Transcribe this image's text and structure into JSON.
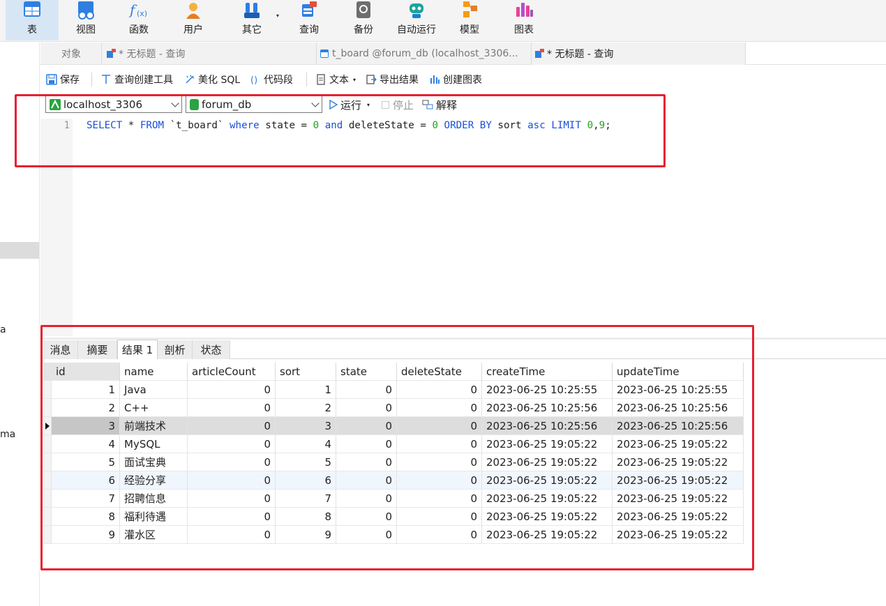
{
  "ribbon": {
    "items": [
      {
        "label": "表",
        "icon": "table-icon"
      },
      {
        "label": "视图",
        "icon": "view-icon"
      },
      {
        "label": "函数",
        "icon": "function-icon"
      },
      {
        "label": "用户",
        "icon": "user-icon"
      },
      {
        "label": "其它",
        "icon": "other-icon"
      },
      {
        "label": "查询",
        "icon": "query-icon"
      },
      {
        "label": "备份",
        "icon": "backup-icon"
      },
      {
        "label": "自动运行",
        "icon": "automation-icon"
      },
      {
        "label": "模型",
        "icon": "model-icon"
      },
      {
        "label": "图表",
        "icon": "chart-icon"
      }
    ],
    "dropdown_glyph": "▾"
  },
  "sidebar": {
    "fragment_1": "a",
    "fragment_2": "ma"
  },
  "tabs": [
    {
      "label": "对象"
    },
    {
      "label": "* 无标题 - 查询"
    },
    {
      "label": "t_board @forum_db (localhost_3306..."
    },
    {
      "label": "* 无标题 - 查询"
    }
  ],
  "editor_toolbar": {
    "save": "保存",
    "query_builder": "查询创建工具",
    "beautify": "美化 SQL",
    "snippet": "代码段",
    "text": "文本",
    "export": "导出结果",
    "create_chart": "创建图表"
  },
  "connection": {
    "server": "localhost_3306",
    "database": "forum_db",
    "run": "运行",
    "stop": "停止",
    "explain": "解释"
  },
  "editor": {
    "line_number": "1",
    "sql": {
      "t1": "SELECT",
      "t2": " * ",
      "t3": "FROM",
      "t4": " `t_board` ",
      "t5": "where",
      "t6": " state = ",
      "t7": "0",
      "t8": " ",
      "t9": "and",
      "t10": " deleteState = ",
      "t11": "0",
      "t12": " ",
      "t13": "ORDER BY",
      "t14": " sort ",
      "t15": "asc",
      "t16": " ",
      "t17": "LIMIT",
      "t18": " ",
      "t19": "0",
      "t20": ",",
      "t21": "9",
      "t22": ";"
    }
  },
  "result_tabs": [
    "消息",
    "摘要",
    "结果 1",
    "剖析",
    "状态"
  ],
  "result": {
    "columns": [
      "id",
      "name",
      "articleCount",
      "sort",
      "state",
      "deleteState",
      "createTime",
      "updateTime"
    ],
    "rows": [
      [
        "1",
        "Java",
        "0",
        "1",
        "0",
        "0",
        "2023-06-25 10:25:55",
        "2023-06-25 10:25:55"
      ],
      [
        "2",
        "C++",
        "0",
        "2",
        "0",
        "0",
        "2023-06-25 10:25:56",
        "2023-06-25 10:25:56"
      ],
      [
        "3",
        "前端技术",
        "0",
        "3",
        "0",
        "0",
        "2023-06-25 10:25:56",
        "2023-06-25 10:25:56"
      ],
      [
        "4",
        "MySQL",
        "0",
        "4",
        "0",
        "0",
        "2023-06-25 19:05:22",
        "2023-06-25 19:05:22"
      ],
      [
        "5",
        "面试宝典",
        "0",
        "5",
        "0",
        "0",
        "2023-06-25 19:05:22",
        "2023-06-25 19:05:22"
      ],
      [
        "6",
        "经验分享",
        "0",
        "6",
        "0",
        "0",
        "2023-06-25 19:05:22",
        "2023-06-25 19:05:22"
      ],
      [
        "7",
        "招聘信息",
        "0",
        "7",
        "0",
        "0",
        "2023-06-25 19:05:22",
        "2023-06-25 19:05:22"
      ],
      [
        "8",
        "福利待遇",
        "0",
        "8",
        "0",
        "0",
        "2023-06-25 19:05:22",
        "2023-06-25 19:05:22"
      ],
      [
        "9",
        "灌水区",
        "0",
        "9",
        "0",
        "0",
        "2023-06-25 19:05:22",
        "2023-06-25 19:05:22"
      ]
    ],
    "selected_row": 3
  },
  "colors": {
    "keyword": "#1a4fd6",
    "number": "#22a022",
    "highlight": "#e8202f",
    "ribbon_active": "#d7e6f5"
  }
}
